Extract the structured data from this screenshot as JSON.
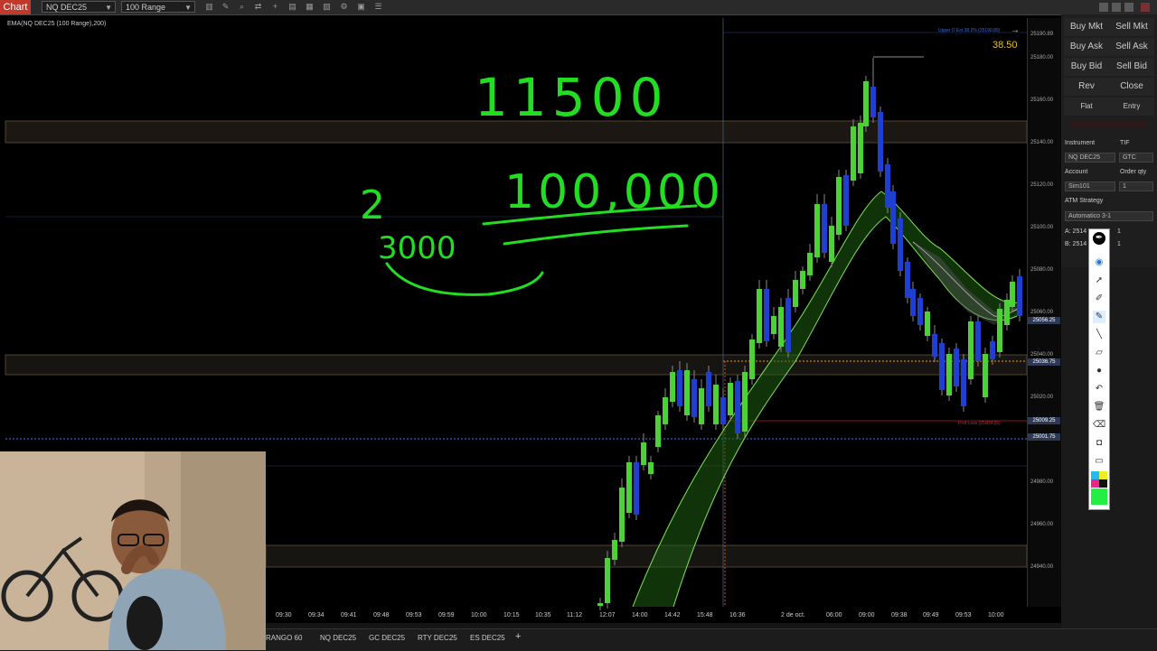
{
  "toolbar": {
    "chart_tab": "Chart",
    "instrument": "NQ DEC25",
    "bar_type": "100 Range"
  },
  "indicator_label": "EMA(NQ DEC25 (100 Range),200)",
  "price_axis": {
    "ticks": [
      "25190.89",
      "25180.00",
      "25160.00",
      "25140.00",
      "25120.00",
      "25100.00",
      "25080.00",
      "25060.00",
      "25056.25",
      "25040.00",
      "25036.75",
      "25020.00",
      "25009.25",
      "25001.75",
      "24980.00",
      "24960.00",
      "24940.00"
    ],
    "current_value": "38.50"
  },
  "time_axis": [
    "09:30",
    "09:34",
    "09:41",
    "09:48",
    "09:53",
    "09:59",
    "10:00",
    "10:15",
    "10:35",
    "11:12",
    "12:07",
    "14:00",
    "14:42",
    "15:48",
    "16:36",
    "2 de oct.",
    "06:00",
    "09:00",
    "09:38",
    "09:49",
    "09:53",
    "10:00"
  ],
  "chart_annotations": {
    "upper_ext": "Upper D Ext 38.2% (25190.89)",
    "profit_label": "Prof Loss (25009.25)"
  },
  "handwriting": {
    "top": "11500",
    "middle": "100,000",
    "left_top": "2",
    "left_bottom": "3000"
  },
  "order_panel": {
    "buy_mkt": "Buy Mkt",
    "sell_mkt": "Sell Mkt",
    "buy_ask": "Buy Ask",
    "sell_ask": "Sell Ask",
    "buy_bid": "Buy Bid",
    "sell_bid": "Sell Bid",
    "rev": "Rev",
    "close": "Close",
    "flat": "Flat",
    "entry": "Entry",
    "instrument_label": "Instrument",
    "tif_label": "TIF",
    "instrument_value": "NQ DEC25",
    "tif_value": "GTC",
    "account_label": "Account",
    "order_qty_label": "Order qty",
    "account_value": "Sim101",
    "order_qty_value": "1",
    "atm_label": "ATM Strategy",
    "atm_value": "Automatico 3-1",
    "a_label": "A: 2514",
    "b_label": "B: 2514",
    "a_qty": "1",
    "b_qty": "1"
  },
  "bottom_tabs": [
    "RANGO 60",
    "NQ DEC25",
    "GC DEC25",
    "RTY DEC25",
    "ES DEC25",
    "+"
  ],
  "colors": {
    "bull": "#4cd137",
    "bear": "#1f3fd1",
    "ink": "#22dd22",
    "chart_tab": "#c0392b"
  }
}
